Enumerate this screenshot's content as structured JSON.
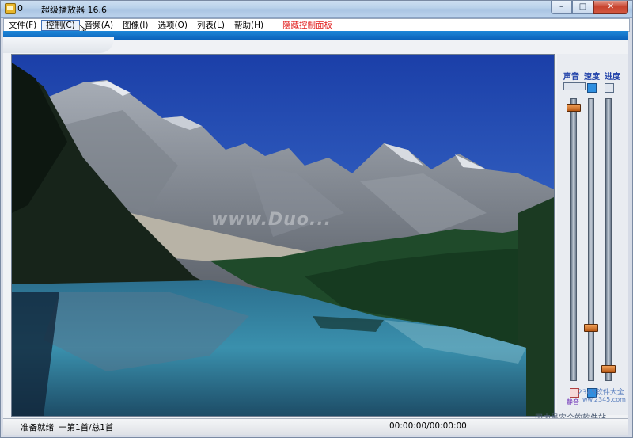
{
  "window": {
    "title_number": "0",
    "title": "超级播放器 16.6",
    "min_label": "–",
    "max_label": "□",
    "close_label": "✕"
  },
  "menu": {
    "file": "文件(F)",
    "control": "控制(C)",
    "audio": "音频(A)",
    "image": "图像(I)",
    "options": "选项(O)",
    "list": "列表(L)",
    "help": "帮助(H)",
    "hide_panel": "隐藏控制面板"
  },
  "video": {
    "watermark": "www.Duo..."
  },
  "controls": {
    "volume_label": "声音",
    "speed_label": "速度",
    "progress_label": "进度",
    "volume_level": 0.98,
    "speed_level": 0.18,
    "progress_level": 0.03,
    "mute_text": "静音",
    "logo_text": "2345软件大全",
    "logo_url": "ww.2345.com"
  },
  "footer_watermark": "国内最安全的软件站",
  "status": {
    "ready": "准备就绪",
    "track": "一第1首/总1首",
    "time": "00:00:00/00:00:00"
  }
}
